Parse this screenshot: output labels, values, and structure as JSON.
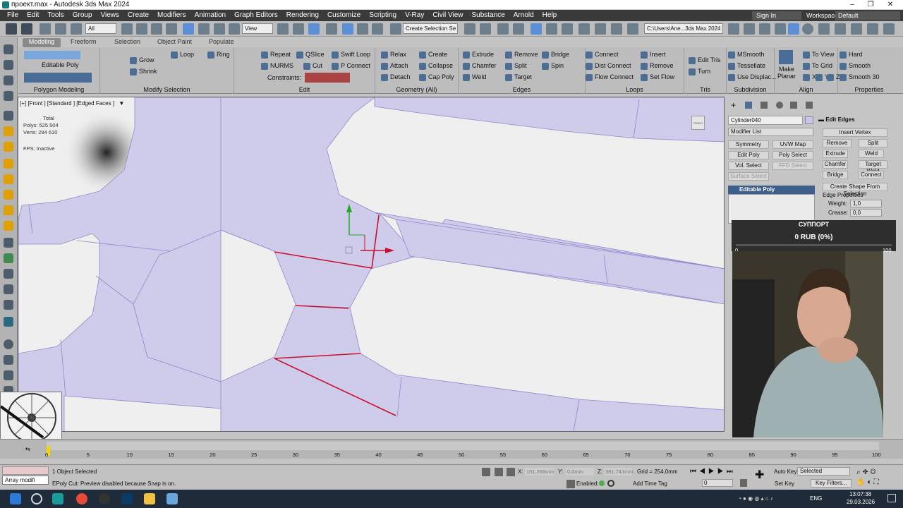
{
  "window": {
    "title": "проект.max - Autodesk 3ds Max 2024"
  },
  "menu": [
    "File",
    "Edit",
    "Tools",
    "Group",
    "Views",
    "Create",
    "Modifiers",
    "Animation",
    "Graph Editors",
    "Rendering",
    "Customize",
    "Scripting",
    "V-Ray",
    "Civil View",
    "Substance",
    "Arnold",
    "Help"
  ],
  "account": {
    "signin": "Sign In",
    "workspaces_label": "Workspaces:",
    "workspace": "Default"
  },
  "toolbar": {
    "filter": "All",
    "view": "View",
    "selection_set": "Create Selection Se",
    "path": "C:\\Users\\Ane...3ds Max 2024"
  },
  "ribbon_tabs": [
    "Modeling",
    "Freeform",
    "Selection",
    "Object Paint",
    "Populate"
  ],
  "ribbon": {
    "polygon_modeling": {
      "label": "Polygon Modeling",
      "item": "Editable Poly"
    },
    "modify_selection": {
      "label": "Modify Selection",
      "grow": "Grow",
      "shrink": "Shrink",
      "loop": "Loop",
      "ring": "Ring"
    },
    "edit": {
      "label": "Edit",
      "repeat": "Repeat",
      "qslice": "QSlice",
      "swift_loop": "Swift Loop",
      "nurms": "NURMS",
      "cut": "Cut",
      "p_connect": "P Connect",
      "constraints": "Constraints:"
    },
    "geometry": {
      "label": "Geometry (All)",
      "relax": "Relax",
      "create": "Create",
      "attach": "Attach",
      "collapse": "Collapse",
      "detach": "Detach",
      "cap_poly": "Cap Poly"
    },
    "edges": {
      "label": "Edges",
      "extrude": "Extrude",
      "remove": "Remove",
      "bridge": "Bridge",
      "chamfer": "Chamfer",
      "split": "Split",
      "spin": "Spin",
      "weld": "Weld",
      "target": "Target"
    },
    "loops": {
      "label": "Loops",
      "connect": "Connect",
      "dist_connect": "Dist Connect",
      "flow_connect": "Flow Connect",
      "insert": "Insert",
      "remove": "Remove",
      "set_flow": "Set Flow"
    },
    "tris": {
      "label": "Tris",
      "edit_tris": "Edit Tris",
      "turn": "Turn"
    },
    "subdivision": {
      "label": "Subdivision",
      "msmooth": "MSmooth",
      "tessellate": "Tessellate",
      "use_displac": "Use Displac..."
    },
    "align": {
      "label": "Align",
      "make_planar": "Make Planar",
      "to_view": "To View",
      "to_grid": "To Grid",
      "x": "X",
      "y": "Y",
      "z": "Z"
    },
    "properties": {
      "label": "Properties",
      "hard": "Hard",
      "smooth": "Smooth",
      "smooth30": "Smooth 30"
    }
  },
  "viewport": {
    "label": "[+] [Front ] [Standard ] [Edged Faces ]",
    "total": "Total",
    "polys": "Polys:  525 504",
    "verts": "Verts:  294 610",
    "fps": "FPS:    Inactive",
    "viewcube": "FRONT",
    "mesh_color": "#cfcbeb",
    "edge_color": "#c8102e"
  },
  "command_panel": {
    "object_name": "Cylinder040",
    "modifier_list": "Modifier List",
    "buttons": [
      "Symmetry",
      "UVW Map",
      "Edit Poly",
      "Poly Select",
      "Vol. Select",
      "FFD Select",
      "Surface Select"
    ],
    "stack_item": "Editable Poly",
    "rollout_title": "Edit Edges",
    "insert_vertex": "Insert Vertex",
    "remove": "Remove",
    "split": "Split",
    "extrude": "Extrude",
    "weld": "Weld",
    "chamfer": "Chamfer",
    "target_weld": "Target Weld",
    "bridge": "Bridge",
    "connect": "Connect",
    "create_shape": "Create Shape From Selection",
    "edge_properties": "Edge Properties",
    "weight_label": "Weight:",
    "weight": "1,0",
    "crease_label": "Crease:",
    "crease": "0,0"
  },
  "donation": {
    "title": "СУППОРТ",
    "amount": "0 RUB (0%)",
    "min": "0",
    "max": "100",
    "progress": 0
  },
  "timeline": {
    "ticks": [
      "0",
      "5",
      "10",
      "15",
      "20",
      "25",
      "30",
      "35",
      "40",
      "45",
      "50",
      "55",
      "60",
      "65",
      "70",
      "75",
      "80",
      "85",
      "90",
      "95",
      "100"
    ],
    "frame": "0 / 100"
  },
  "status": {
    "objects": "1 Object Selected",
    "message": "EPoly Cut: Preview disabled because Snap is on.",
    "x_label": "X:",
    "x": "151,266mm",
    "y_label": "Y:",
    "y": "0,0mm",
    "z_label": "Z:",
    "z": "391,741mm",
    "grid": "Grid = 254,0mm",
    "enabled": "Enabled:",
    "add_time_tag": "Add Time Tag",
    "auto_key": "Auto Key",
    "selected": "Selected",
    "set_key": "Set Key",
    "key_filters": "Key Filters...",
    "frame": "0",
    "array_modifier": "Array modifi"
  },
  "taskbar": {
    "lang": "ENG",
    "time": "13:07:38",
    "date": "29.03.2026"
  }
}
